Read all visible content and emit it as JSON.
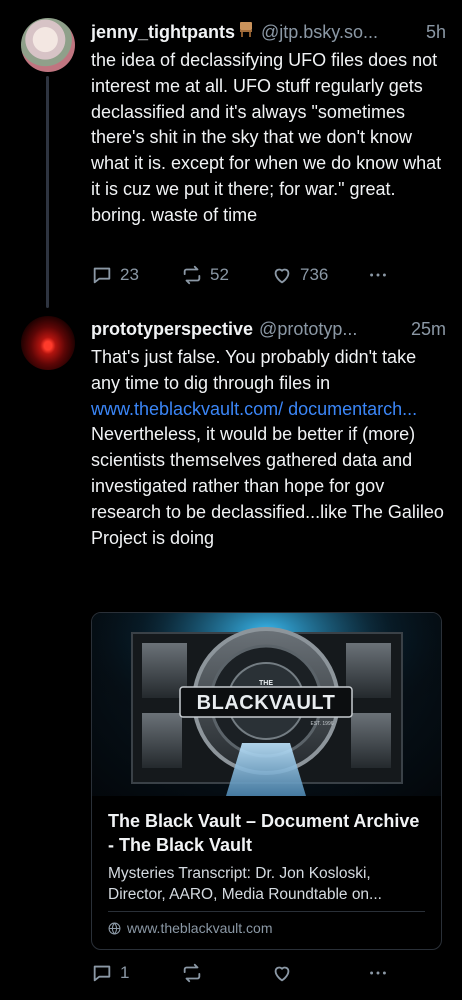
{
  "thread": [
    {
      "author": "jenny_tightpants",
      "handle": "@jtp.bsky.so...",
      "time": "5h",
      "text": "the idea of declassifying UFO files does not interest me at all. UFO stuff regularly gets declassified and it's always \"sometimes there's shit in the sky that we don't know what it is. except for when we do know what it is cuz we put it there; for war.\" great. boring. waste of time",
      "replies": "23",
      "reposts": "52",
      "likes": "736"
    },
    {
      "author": "prototyperspective",
      "handle": "@prototyp...",
      "time": "25m",
      "text_before_link": "That's just false. You probably didn't take any time to dig through files in ",
      "link_text": "www.theblackvault.com/ documentarch...",
      "text_after_link": "Nevertheless, it would be better if (more) scientists themselves gathered data and investigated rather than hope for gov research to be declassified...like The Galileo Project is doing",
      "replies": "1",
      "card": {
        "image_logo": "BLACKVAULT",
        "image_small": "THE",
        "image_est": "EST. 1996",
        "title": "The Black Vault – Document Archive - The Black Vault",
        "description": "Mysteries Transcript: Dr. Jon Kosloski, Director, AARO, Media Roundtable on...",
        "domain": "www.theblackvault.com"
      }
    }
  ],
  "colors": {
    "background": "#000000",
    "text": "#f1f3f5",
    "muted": "#8b98a5",
    "link": "#3b86f7"
  }
}
